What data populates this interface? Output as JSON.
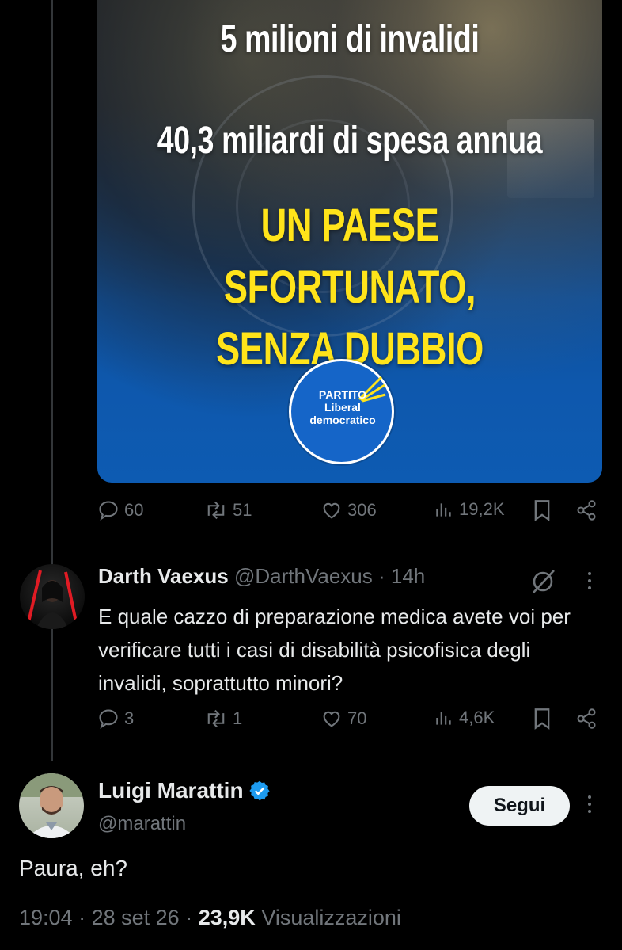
{
  "media": {
    "line1": "5 milioni di invalidi",
    "line2": "40,3 miliardi di spesa annua",
    "line3a": "UN PAESE SFORTUNATO,",
    "line3b": "SENZA DUBBIO",
    "logo": {
      "l1": "PARTITO",
      "l2": "Liberal",
      "l3": "democratico"
    }
  },
  "quoted_actions": {
    "replies": "60",
    "retweets": "51",
    "likes": "306",
    "views": "19,2K"
  },
  "reply": {
    "name": "Darth Vaexus",
    "handle": "@DarthVaexus",
    "sep": "·",
    "time": "14h",
    "text": "E quale cazzo di preparazione medica avete voi per verificare tutti i casi di disabilità psicofisica degli invalidi, soprattutto minori?",
    "actions": {
      "replies": "3",
      "retweets": "1",
      "likes": "70",
      "views": "4,6K"
    }
  },
  "main": {
    "name": "Luigi Marattin",
    "handle": "@marattin",
    "follow_label": "Segui",
    "text": "Paura, eh?",
    "time": "19:04",
    "sep1": "·",
    "date": "28 set 26",
    "sep2": "·",
    "views": "23,9K",
    "views_label": "Visualizzazioni"
  },
  "colors": {
    "background": "#000000",
    "muted": "#71767b",
    "verified": "#1d9bf0",
    "headline_yellow": "#ffe41a"
  }
}
